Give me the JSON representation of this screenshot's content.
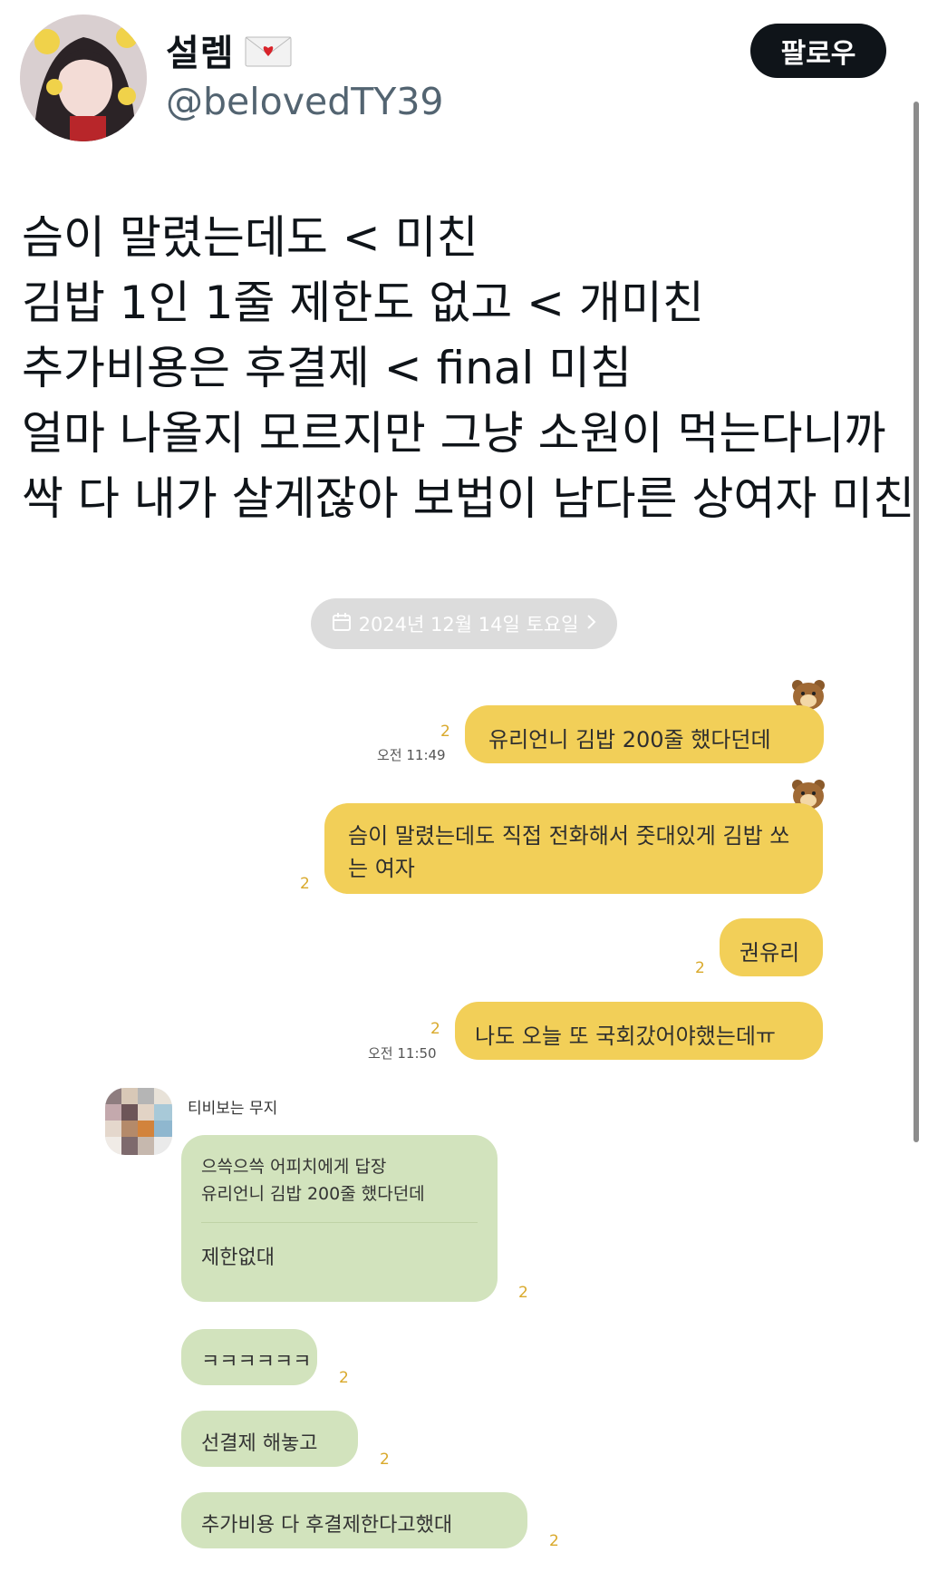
{
  "header": {
    "display_name": "설렘",
    "handle": "@belovedTY39",
    "follow_label": "팔로우"
  },
  "tweet": {
    "lines": [
      "슴이 말렸는데도 < 미친",
      "김밥 1인 1줄 제한도 없고 < 개미친",
      "추가비용은 후결제 < final 미침",
      "얼마 나올지 모르지만 그냥 소원이 먹는다니까",
      "싹 다 내가 살게잖아 보법이 남다른 상여자 미친"
    ]
  },
  "chat": {
    "date_label": "2024년 12월 14일 토요일",
    "outgoing": [
      {
        "text": "유리언니 김밥 200줄 했다던데",
        "unread": "2",
        "time": "오전 11:49"
      },
      {
        "text": "슴이 말렸는데도 직접 전화해서 줏대있게 김밥 쏘는 여자",
        "unread": "2",
        "time": ""
      },
      {
        "text": "권유리",
        "unread": "2",
        "time": ""
      },
      {
        "text": "나도 오늘 또 국회갔어야했는데ㅠ",
        "unread": "2",
        "time": "오전 11:50"
      }
    ],
    "sender_name": "티비보는 무지",
    "reply": {
      "quote_line1": "으쓱으쓱 어피치에게 답장",
      "quote_line2": "유리언니 김밥 200줄 했다던데",
      "text": "제한없대",
      "unread": "2"
    },
    "incoming": [
      {
        "text": "ㅋㅋㅋㅋㅋㅋ",
        "unread": "2"
      },
      {
        "text": "선결제 해놓고",
        "unread": "2"
      },
      {
        "text": "추가비용 다 후결제한다고했대",
        "unread": "2"
      }
    ]
  },
  "colors": {
    "outgoing_bubble": "#f2cf58",
    "incoming_bubble": "#d2e3bd",
    "follow_button": "#0f1419",
    "handle": "#536471"
  },
  "icons": [
    "envelope-heart-icon",
    "calendar-icon",
    "chevron-right-icon",
    "bear-profile-icon"
  ]
}
